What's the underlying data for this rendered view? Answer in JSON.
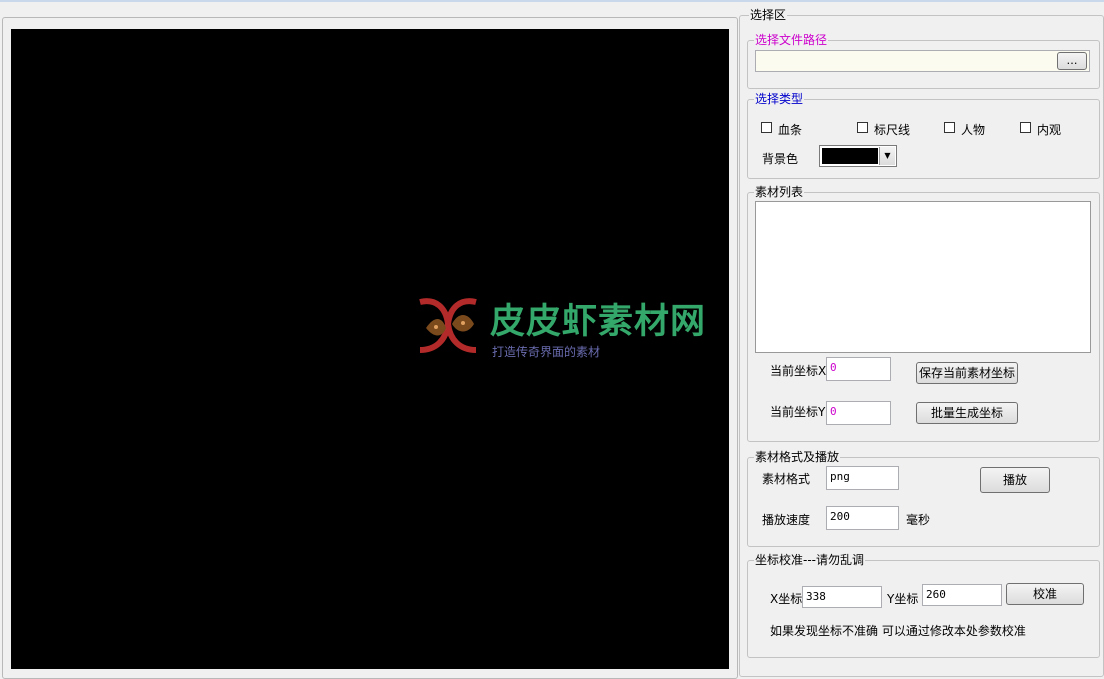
{
  "watermark": {
    "title": "皮皮虾素材网",
    "subtitle": "打造传奇界面的素材"
  },
  "select_area": {
    "title": "选择区",
    "file_path": {
      "legend": "选择文件路径",
      "value": "",
      "browse_label": "…"
    },
    "type": {
      "legend": "选择类型",
      "checkboxes": [
        {
          "label": "血条",
          "checked": false
        },
        {
          "label": "标尺线",
          "checked": false
        },
        {
          "label": "人物",
          "checked": false
        },
        {
          "label": "内观",
          "checked": false
        }
      ],
      "bg_label": "背景色",
      "bg_color": "#000000"
    },
    "material_list": {
      "legend": "素材列表",
      "coord_x_label": "当前坐标X",
      "coord_x_value": "0",
      "coord_y_label": "当前坐标Y",
      "coord_y_value": "0",
      "save_button": "保存当前素材坐标",
      "batch_button": "批量生成坐标"
    },
    "format": {
      "legend": "素材格式及播放",
      "format_label": "素材格式",
      "format_value": "png",
      "play_button": "播放",
      "speed_label": "播放速度",
      "speed_value": "200",
      "speed_unit": "毫秒"
    },
    "calibrate": {
      "legend": "坐标校准---请勿乱调",
      "x_label": "X坐标",
      "x_value": "338",
      "y_label": "Y坐标",
      "y_value": "260",
      "button": "校准",
      "hint": "如果发现坐标不准确 可以通过修改本处参数校准"
    }
  }
}
